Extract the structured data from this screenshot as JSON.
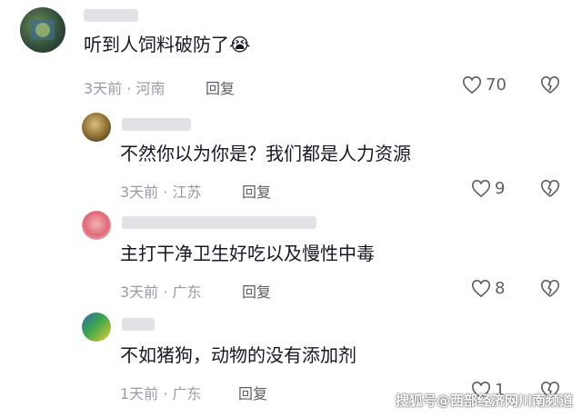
{
  "comments": [
    {
      "text": "听到人饲料破防了",
      "emoji": "😭",
      "meta": "3天前 · 河南",
      "reply_label": "回复",
      "likes": "70"
    },
    {
      "text": "不然你以为你是？我们都是人力资源",
      "meta": "3天前 · 江苏",
      "reply_label": "回复",
      "likes": "9"
    },
    {
      "text": "主打干净卫生好吃以及慢性中毒",
      "meta": "3天前 · 广东",
      "reply_label": "回复",
      "likes": "8"
    },
    {
      "text": "不如猪狗，动物的没有添加剂",
      "meta": "1天前 · 广东",
      "reply_label": "回复",
      "likes": "1"
    }
  ],
  "watermark": "搜狐号@西部经济网川南频道",
  "colors": {
    "text": "#161823",
    "meta": "#9a9ba2",
    "icon": "#5d5e66"
  }
}
